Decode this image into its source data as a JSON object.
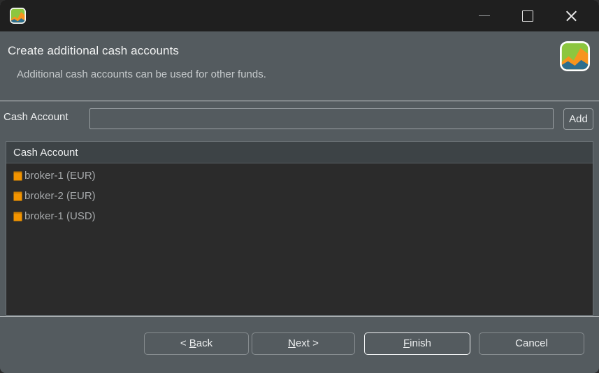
{
  "window": {
    "app_icon": "portfolio-performance-logo",
    "controls": {
      "minimize": "minimize-icon",
      "maximize": "maximize-icon",
      "close": "close-icon"
    }
  },
  "header": {
    "title": "Create additional cash accounts",
    "description": "Additional cash accounts can be used for other funds.",
    "logo": "portfolio-performance-logo"
  },
  "form": {
    "label": "Cash Account",
    "input_value": "",
    "input_placeholder": "",
    "add_label": "Add"
  },
  "table": {
    "columns": [
      "Cash Account"
    ],
    "rows": [
      {
        "icon": "account-icon",
        "label": "broker-1 (EUR)"
      },
      {
        "icon": "account-icon",
        "label": "broker-2 (EUR)"
      },
      {
        "icon": "account-icon",
        "label": "broker-1 (USD)"
      }
    ]
  },
  "buttons": {
    "back": {
      "prefix": "< ",
      "mnemonic": "B",
      "rest": "ack"
    },
    "next": {
      "prefix": "",
      "mnemonic": "N",
      "rest": "ext >"
    },
    "finish": {
      "prefix": "",
      "mnemonic": "F",
      "rest": "inish"
    },
    "cancel": {
      "label": "Cancel"
    }
  },
  "colors": {
    "titlebar_bg": "#1f1f1f",
    "dialog_bg": "#545b5f",
    "table_bg": "#2b2b2b",
    "table_header_bg": "#3d4346",
    "accent_orange": "#f29400",
    "text_primary": "#eceeef",
    "text_muted": "#a7aaac"
  }
}
